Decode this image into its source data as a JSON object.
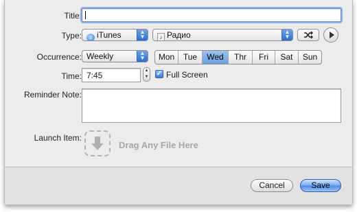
{
  "form": {
    "title_label": "Title:",
    "title_value": "",
    "type_label": "Type:",
    "type_app": "iTunes",
    "type_playlist": "Радио",
    "occurrence_label": "Occurrence:",
    "occurrence_value": "Weekly",
    "days": [
      {
        "label": "Mon",
        "selected": false
      },
      {
        "label": "Tue",
        "selected": false
      },
      {
        "label": "Wed",
        "selected": true
      },
      {
        "label": "Thr",
        "selected": false
      },
      {
        "label": "Fri",
        "selected": false
      },
      {
        "label": "Sat",
        "selected": false
      },
      {
        "label": "Sun",
        "selected": false
      }
    ],
    "time_label": "Time:",
    "time_value": "7:45",
    "fullscreen_label": "Full Screen",
    "fullscreen_checked": true,
    "reminder_label": "Reminder Note:",
    "reminder_value": "",
    "launch_label": "Launch Item:",
    "drag_text": "Drag Any File Here"
  },
  "buttons": {
    "cancel": "Cancel",
    "save": "Save"
  },
  "icons": {
    "shuffle": "shuffle-icon",
    "play": "play-icon",
    "download": "download-arrow-icon"
  },
  "colors": {
    "accent": "#4d8be6",
    "sheet_bg": "#ececec"
  }
}
